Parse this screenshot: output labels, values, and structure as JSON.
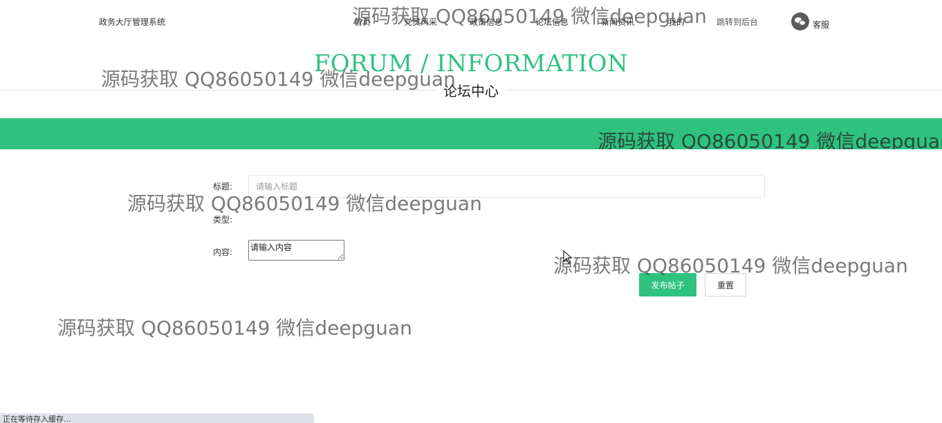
{
  "header": {
    "system_title": "政务大厅管理系统",
    "nav": [
      {
        "label": "首页"
      },
      {
        "label": "党员风采"
      },
      {
        "label": "政策信息"
      },
      {
        "label": "论坛信息"
      },
      {
        "label": "新闻资讯"
      },
      {
        "label": "我的"
      },
      {
        "label": "跳转到后台"
      }
    ],
    "service_label": "客服",
    "service_icon": "wechat-icon"
  },
  "hero": {
    "title_en": "FORUM / INFORMATION",
    "title_cn": "论坛中心"
  },
  "form": {
    "title_label": "标题:",
    "title_placeholder": "请输入标题",
    "title_value": "",
    "type_label": "类型:",
    "content_label": "内容:",
    "content_placeholder": "请输入内容",
    "publish_button": "发布帖子",
    "reset_button": "重置"
  },
  "watermark_text": "源码获取 QQ86050149 微信deepguan",
  "status_bar_text": "正在等待存入缓存...",
  "colors": {
    "accent": "#2ec27e",
    "status_bar": "#dee1e6"
  }
}
